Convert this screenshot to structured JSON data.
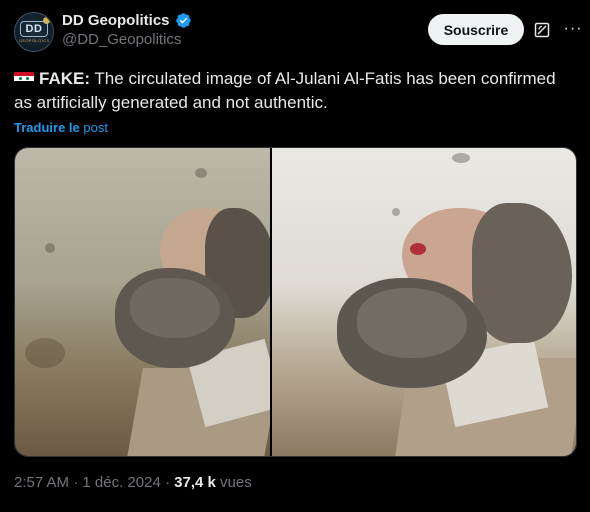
{
  "account": {
    "display_name": "DD Geopolitics",
    "handle": "@DD_Geopolitics",
    "verified": true,
    "avatar": {
      "text": "DD",
      "subtext": "GEOPOLITICS"
    }
  },
  "header": {
    "subscribe_label": "Souscrire",
    "grok_icon": "grok-icon",
    "more_icon": "more-icon"
  },
  "tweet": {
    "flag": "syria-flag",
    "label": "FAKE:",
    "text": "The circulated image of Al-Julani Al-Fatis has been confirmed as artificially generated and not authentic.",
    "translate_prefix": "Traduire le",
    "translate_suffix": "post"
  },
  "meta": {
    "time": "2:57 AM",
    "sep1": "·",
    "date": "1 déc. 2024",
    "sep2": "·",
    "views_count": "37,4 k",
    "views_label": "vues"
  },
  "colors": {
    "accent": "#1d9bf0",
    "verified": "#1d9bf0",
    "background": "#000000",
    "text": "#e7e9ea",
    "muted": "#71767b"
  }
}
